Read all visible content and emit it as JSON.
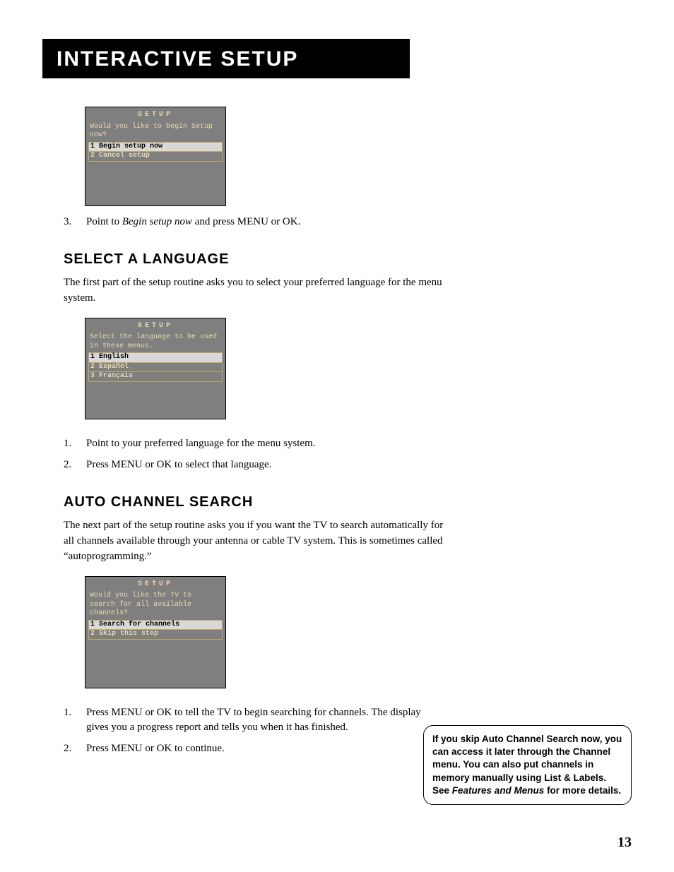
{
  "header": {
    "title": "Interactive Setup"
  },
  "box1": {
    "title": "SETUP",
    "prompt": "Would you like to begin Setup now?",
    "options": [
      {
        "n": "1",
        "label": "Begin setup now",
        "selected": true
      },
      {
        "n": "2",
        "label": "Cancel setup",
        "selected": false
      }
    ]
  },
  "step_after_box1": {
    "n": "3.",
    "pre": "Point to ",
    "emph": "Begin setup now",
    "post": " and press MENU or OK."
  },
  "lang": {
    "heading": "Select a Language",
    "intro": "The first part of the setup routine asks you to select your preferred language for the menu system."
  },
  "box2": {
    "title": "SETUP",
    "prompt": "Select the language to be used in these menus.",
    "options": [
      {
        "n": "1",
        "label": "English",
        "selected": true
      },
      {
        "n": "2",
        "label": "Español",
        "selected": false
      },
      {
        "n": "3",
        "label": "Français",
        "selected": false
      }
    ]
  },
  "lang_steps": [
    {
      "n": "1.",
      "text": "Point to your preferred language for the menu system."
    },
    {
      "n": "2.",
      "text": "Press MENU or OK to select that language."
    }
  ],
  "auto": {
    "heading": "Auto Channel Search",
    "intro": "The next part of the setup routine asks you if you want the TV to search automatically for all channels available through your antenna or cable TV system. This is sometimes called “autoprogramming.”"
  },
  "box3": {
    "title": "SETUP",
    "prompt": "Would you like the TV to search for all available channels?",
    "options": [
      {
        "n": "1",
        "label": "Search for channels",
        "selected": true
      },
      {
        "n": "2",
        "label": "Skip this step",
        "selected": false
      }
    ]
  },
  "auto_steps": [
    {
      "n": "1.",
      "text": "Press MENU or OK to tell the TV to begin searching for channels. The display gives you a progress report and tells you when it has finished."
    },
    {
      "n": "2.",
      "text": "Press MENU or OK to continue."
    }
  ],
  "note": {
    "line1": "If you skip Auto Channel Search now, you can access it later through the Channel menu. You can also put channels in memory manually using List & Labels. See ",
    "emph": "Features and Menus",
    "line2": " for more details."
  },
  "page_number": "13"
}
